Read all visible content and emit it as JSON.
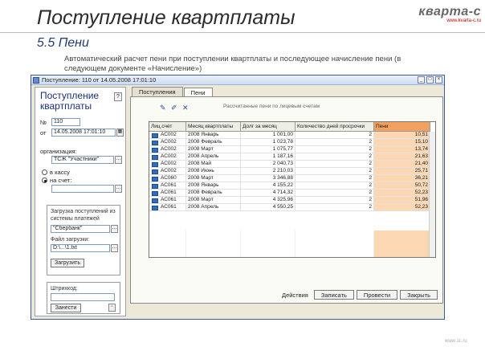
{
  "slide": {
    "title": "Поступление квартплаты",
    "brand_name": "кварта-с",
    "brand_sub": "www.kvarta-c.ru",
    "section": "5.5  Пени",
    "description": "Автоматический расчет пени при поступлении квартплаты и последующее начисление пени (в следующем документе «Начисление»)",
    "page_number": "www.1c.ru"
  },
  "window": {
    "title": "Поступление: 110 от 14.05.2008 17:01:10"
  },
  "left_panel": {
    "title": "Поступление квартплаты",
    "help": "?",
    "number_label": "№",
    "number_value": "110",
    "date_label": "от",
    "date_value": "14.05.2008 17:01:10",
    "org_label": "организация:",
    "org_value": "ТСЖ \"Участники\"",
    "radio_cash": "в кассу",
    "radio_account": "на счет:",
    "load_group_text": "Загрузка поступлений из системы платежей",
    "load_system": "\"Сбербанк\"",
    "file_label": "Файл загрузки:",
    "file_value": "D:\\...\\1.txt",
    "load_button": "Загрузить",
    "pay_group_label": "Штрихкод:",
    "pay_button": "Занести"
  },
  "tabs": [
    "Поступления",
    "Пени"
  ],
  "tab_hint": "Рассчитанные пени по лицевым счетам",
  "grid": {
    "headers": [
      "Лиц.счет",
      "Месяц квартплаты",
      "Долг за месяц",
      "Количество дней просрочки",
      "Пени"
    ],
    "rows": [
      [
        "АС002",
        "2008 Январь",
        "1 001,00",
        "2",
        "10,51"
      ],
      [
        "АС002",
        "2008 Февраль",
        "1 023,78",
        "2",
        "15,10"
      ],
      [
        "АС002",
        "2008 Март",
        "1 075,77",
        "2",
        "13,74"
      ],
      [
        "АС002",
        "2008 Апрель",
        "1 187,16",
        "2",
        "21,63"
      ],
      [
        "АС002",
        "2008 Май",
        "2 040,73",
        "2",
        "21,40"
      ],
      [
        "АС002",
        "2008 Июнь",
        "2 210,03",
        "2",
        "25,71"
      ],
      [
        "АС060",
        "2008 Март",
        "3 346,88",
        "2",
        "36,21"
      ],
      [
        "АС061",
        "2008 Январь",
        "4 155,22",
        "2",
        "50,72"
      ],
      [
        "АС061",
        "2008 Февраль",
        "4 714,32",
        "2",
        "52,23"
      ],
      [
        "АС061",
        "2008 Март",
        "4 325,96",
        "2",
        "51,96"
      ],
      [
        "АС061",
        "2008 Апрель",
        "4 550,25",
        "2",
        "52,23"
      ]
    ]
  },
  "bottom": {
    "actions_label": "Действия",
    "btn_write": "Записать",
    "btn_post": "Провести",
    "btn_close": "Закрыть"
  },
  "colors": {
    "peni_header": "#f2a060",
    "peni_cell": "#fbd7b3",
    "title_blue": "#1a2e7a"
  }
}
